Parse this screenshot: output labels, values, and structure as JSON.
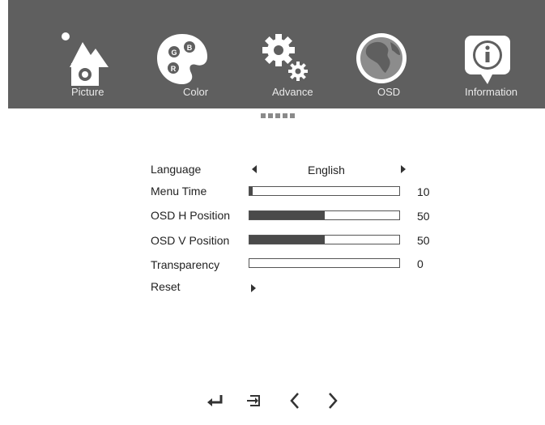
{
  "tabs": [
    {
      "label": "Picture"
    },
    {
      "label": "Color"
    },
    {
      "label": "Advance"
    },
    {
      "label": "OSD"
    },
    {
      "label": "Information"
    }
  ],
  "page_indicator": {
    "count": 5
  },
  "menu": {
    "language": {
      "label": "Language",
      "value": "English"
    },
    "menu_time": {
      "label": "Menu Time",
      "value": "10",
      "level": 0.02
    },
    "osd_h_position": {
      "label": "OSD H Position",
      "value": "50",
      "level": 0.5
    },
    "osd_v_position": {
      "label": "OSD V Position",
      "value": "50",
      "level": 0.5
    },
    "transparency": {
      "label": "Transparency",
      "value": "0",
      "level": 0
    },
    "reset": {
      "label": "Reset"
    }
  },
  "colors": {
    "header_bg": "#5f5f5f",
    "bar_fill": "#4a4a4a"
  },
  "nav_icons": [
    "enter-icon",
    "exit-icon",
    "left-chevron-icon",
    "right-chevron-icon"
  ]
}
